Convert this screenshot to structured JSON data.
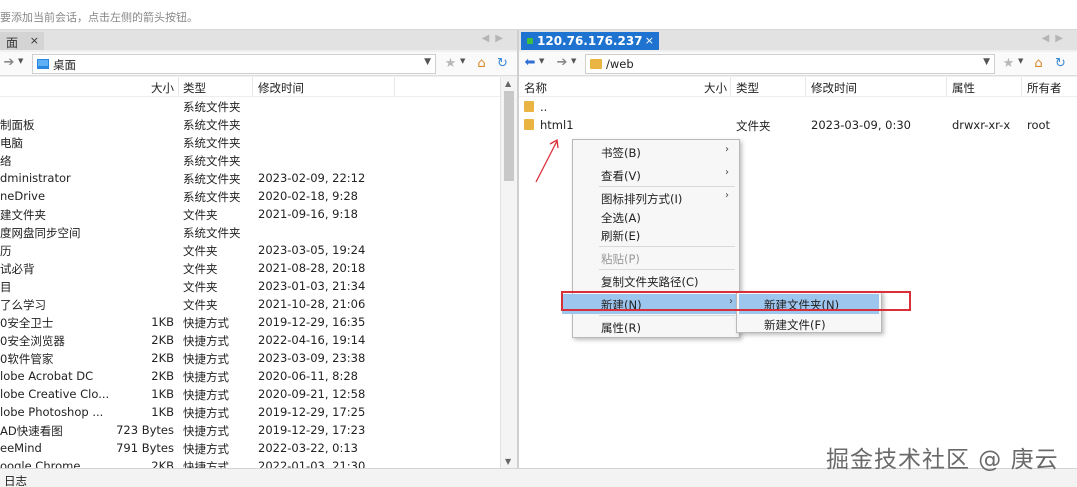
{
  "hint_text": "要添加当前会话，点击左侧的箭头按钮。",
  "left": {
    "tab_label": "面",
    "tab_close": "×",
    "path": "桌面",
    "columns": {
      "size": "大小",
      "type": "类型",
      "modified": "修改时间"
    },
    "rows": [
      {
        "name": "",
        "size": "",
        "type": "系统文件夹",
        "modified": ""
      },
      {
        "name": "制面板",
        "size": "",
        "type": "系统文件夹",
        "modified": ""
      },
      {
        "name": "电脑",
        "size": "",
        "type": "系统文件夹",
        "modified": ""
      },
      {
        "name": "络",
        "size": "",
        "type": "系统文件夹",
        "modified": ""
      },
      {
        "name": "dministrator",
        "size": "",
        "type": "系统文件夹",
        "modified": "2023-02-09, 22:12"
      },
      {
        "name": "neDrive",
        "size": "",
        "type": "系统文件夹",
        "modified": "2020-02-18, 9:28"
      },
      {
        "name": "建文件夹",
        "size": "",
        "type": "文件夹",
        "modified": "2021-09-16, 9:18"
      },
      {
        "name": "度网盘同步空间",
        "size": "",
        "type": "系统文件夹",
        "modified": ""
      },
      {
        "name": "历",
        "size": "",
        "type": "文件夹",
        "modified": "2023-03-05, 19:24"
      },
      {
        "name": "试必背",
        "size": "",
        "type": "文件夹",
        "modified": "2021-08-28, 20:18"
      },
      {
        "name": "目",
        "size": "",
        "type": "文件夹",
        "modified": "2023-01-03, 21:34"
      },
      {
        "name": "了么学习",
        "size": "",
        "type": "文件夹",
        "modified": "2021-10-28, 21:06"
      },
      {
        "name": "0安全卫士",
        "size": "1KB",
        "type": "快捷方式",
        "modified": "2019-12-29, 16:35"
      },
      {
        "name": "0安全浏览器",
        "size": "2KB",
        "type": "快捷方式",
        "modified": "2022-04-16, 19:14"
      },
      {
        "name": "0软件管家",
        "size": "2KB",
        "type": "快捷方式",
        "modified": "2023-03-09, 23:38"
      },
      {
        "name": "lobe Acrobat DC",
        "size": "2KB",
        "type": "快捷方式",
        "modified": "2020-06-11, 8:28"
      },
      {
        "name": "lobe Creative Clo...",
        "size": "1KB",
        "type": "快捷方式",
        "modified": "2020-09-21, 12:58"
      },
      {
        "name": "lobe Photoshop ...",
        "size": "1KB",
        "type": "快捷方式",
        "modified": "2019-12-29, 17:25"
      },
      {
        "name": "AD快速看图",
        "size": "723 Bytes",
        "type": "快捷方式",
        "modified": "2019-12-29, 17:23"
      },
      {
        "name": "eeMind",
        "size": "791 Bytes",
        "type": "快捷方式",
        "modified": "2022-03-22, 0:13"
      },
      {
        "name": "oogle Chrome",
        "size": "2KB",
        "type": "快捷方式",
        "modified": "2022-01-03, 21:30"
      }
    ]
  },
  "right": {
    "tab_label": "120.76.176.237",
    "tab_close": "×",
    "path": "/web",
    "columns": {
      "name": "名称",
      "size": "大小",
      "type": "类型",
      "modified": "修改时间",
      "attrs": "属性",
      "owner": "所有者"
    },
    "rows": [
      {
        "name": "..",
        "size": "",
        "type": "",
        "modified": "",
        "attrs": "",
        "owner": ""
      },
      {
        "name": "html1",
        "size": "",
        "type": "文件夹",
        "modified": "2023-03-09, 0:30",
        "attrs": "drwxr-xr-x",
        "owner": "root"
      }
    ]
  },
  "context_menu": {
    "items": [
      {
        "label": "书签(B)",
        "has_submenu": true,
        "disabled": false
      },
      {
        "label": "查看(V)",
        "has_submenu": true,
        "disabled": false
      },
      {
        "label": "图标排列方式(I)",
        "has_submenu": true,
        "disabled": false
      },
      {
        "label": "全选(A)",
        "has_submenu": false,
        "disabled": false
      },
      {
        "label": "刷新(E)",
        "has_submenu": false,
        "disabled": false
      },
      {
        "label": "粘贴(P)",
        "has_submenu": false,
        "disabled": true
      },
      {
        "label": "复制文件夹路径(C)",
        "has_submenu": false,
        "disabled": false
      },
      {
        "label": "新建(N)",
        "has_submenu": true,
        "disabled": false,
        "active": true
      },
      {
        "label": "属性(R)",
        "has_submenu": false,
        "disabled": false
      }
    ],
    "submenu_items": [
      {
        "label": "新建文件夹(N)",
        "active": true
      },
      {
        "label": "新建文件(F)",
        "active": false
      }
    ]
  },
  "status": {
    "log_label": "日志"
  },
  "watermark": "掘金技术社区 @ 庚云",
  "colors": {
    "tab_active": "#1e73d0",
    "menu_highlight": "#9cc6ee",
    "annotation": "#d8303b",
    "folder": "#e9b441"
  }
}
